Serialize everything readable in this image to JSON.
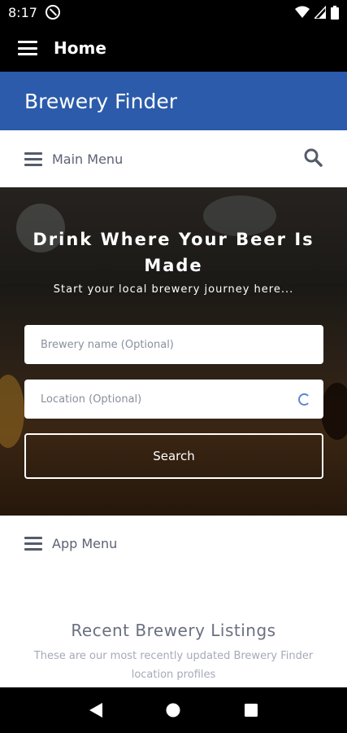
{
  "status_bar": {
    "time": "8:17"
  },
  "app_bar": {
    "title": "Home"
  },
  "brand": {
    "name": "Brewery Finder"
  },
  "main_menu": {
    "label": "Main Menu"
  },
  "hero": {
    "heading": "Drink Where Your Beer Is Made",
    "subheading": "Start your local brewery journey here...",
    "name_placeholder": "Brewery name (Optional)",
    "location_placeholder": "Location (Optional)",
    "search_label": "Search"
  },
  "app_menu": {
    "label": "App Menu"
  },
  "recent": {
    "title": "Recent Brewery Listings",
    "description": "These are our most recently updated Brewery Finder location profiles"
  },
  "colors": {
    "brand": "#2b5baa",
    "accent": "#5b86d6"
  }
}
